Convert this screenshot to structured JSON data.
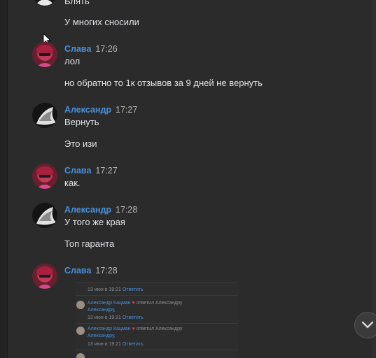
{
  "messages": [
    {
      "text": "Блять"
    },
    {
      "text": "У многих сносили"
    },
    {
      "author": "Слава",
      "time": "17:26"
    },
    {
      "text": "лол"
    },
    {
      "text": "но обратно то 1к отзывов за 9 дней не вернуть"
    },
    {
      "author": "Александр",
      "time": "17:27"
    },
    {
      "text": "Вернуть"
    },
    {
      "text": "Это изи"
    },
    {
      "author": "Слава",
      "time": "17:27"
    },
    {
      "text": "как."
    },
    {
      "author": "Александр",
      "time": "17:28"
    },
    {
      "text": "У того же края"
    },
    {
      "text": "Топ гаранта"
    },
    {
      "author": "Слава",
      "time": "17:28"
    }
  ],
  "embedded": {
    "row1": {
      "date": "13 июн в 19:21",
      "reply": "Ответить"
    },
    "reply1": {
      "name": "Александр Кацман",
      "action": "ответил Александру",
      "addressee": "Александру,",
      "date": "13 июн в 19:21",
      "reply": "Ответить"
    },
    "reply2": {
      "name": "Александр Кацман",
      "action": "ответил Александру",
      "addressee": "Александру,",
      "date": "13 июн в 19:21",
      "reply": "Ответить"
    }
  },
  "colors": {
    "background": "#2b2b2c",
    "author_link": "#4a90d9",
    "text": "#e1e3e6"
  },
  "icons": {
    "scroll_down": "chevron-down-icon",
    "cursor": "mouse-cursor-icon"
  }
}
